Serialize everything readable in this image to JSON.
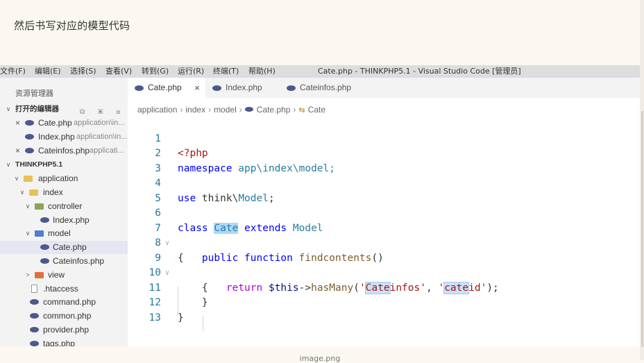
{
  "article": {
    "text": "然后书写对应的模型代码"
  },
  "caption": "image.png",
  "window": {
    "menu": [
      "文件(F)",
      "编辑(E)",
      "选择(S)",
      "查看(V)",
      "转到(G)",
      "运行(R)",
      "终端(T)",
      "帮助(H)"
    ],
    "title": "Cate.php - THINKPHP5.1 - Visual Studio Code [管理员]"
  },
  "explorer": {
    "title": "资源管理器",
    "open_editors_label": "打开的编辑器",
    "open_editors_actions": "⧉ ▣ ⧈",
    "open_editors": [
      {
        "name": "Cate.php",
        "path": "application\\in...",
        "close": "×"
      },
      {
        "name": "Index.php",
        "path": "application\\in...",
        "close": ""
      },
      {
        "name": "Cateinfos.php",
        "path": "applicati...",
        "close": "×"
      }
    ],
    "project_label": "THINKPHP5.1",
    "tree": [
      {
        "name": "application",
        "chev": "∨",
        "icon": "folder"
      },
      {
        "name": "index",
        "chev": "∨",
        "icon": "folder"
      },
      {
        "name": "controller",
        "chev": "∨",
        "icon": "folder-ctrl"
      },
      {
        "name": "Index.php",
        "chev": "",
        "icon": "php"
      },
      {
        "name": "model",
        "chev": "∨",
        "icon": "folder-model"
      },
      {
        "name": "Cate.php",
        "chev": "",
        "icon": "php"
      },
      {
        "name": "Cateinfos.php",
        "chev": "",
        "icon": "php"
      },
      {
        "name": "view",
        "chev": ">",
        "icon": "folder-view"
      },
      {
        "name": ".htaccess",
        "chev": "",
        "icon": "file"
      },
      {
        "name": "command.php",
        "chev": "",
        "icon": "php"
      },
      {
        "name": "common.php",
        "chev": "",
        "icon": "php"
      },
      {
        "name": "provider.php",
        "chev": "",
        "icon": "php"
      },
      {
        "name": "tags.php",
        "chev": "",
        "icon": "php"
      }
    ]
  },
  "tabs": [
    {
      "label": "Cate.php",
      "close": "×"
    },
    {
      "label": "Index.php"
    },
    {
      "label": "Cateinfos.php"
    }
  ],
  "breadcrumb": {
    "parts": [
      "application",
      "index",
      "model"
    ],
    "file": "Cate.php",
    "class": "Cate",
    "class_icon": "⇆"
  },
  "code": {
    "line_numbers": [
      "1",
      "2",
      "3",
      "4",
      "5",
      "6",
      "7",
      "8",
      "9",
      "10",
      "11",
      "12",
      "13"
    ],
    "l1": "<?php",
    "l2_kw": "namespace",
    "l2_ns": " app\\index\\model;",
    "l4_kw": "use",
    "l4_a": " think\\",
    "l4_b": "Model",
    "l4_c": ";",
    "l6_kw1": "class",
    "l6_name": "Cate",
    "l6_kw2": "extends",
    "l6_base": "Model",
    "l7": "{",
    "l8_kw1": "public",
    "l8_kw2": "function",
    "l8_fn": "findcontents",
    "l8_p": "()",
    "l9": "{",
    "l10_ret": "return",
    "l10_var": "$this",
    "l10_arrow": "->",
    "l10_fn": "hasMany",
    "l10_p1": "(",
    "l10_s1a": "'",
    "l10_s1b": "Cate",
    "l10_s1c": "infos'",
    "l10_comma": ", ",
    "l10_s2a": "'",
    "l10_s2b": "cate",
    "l10_s2c": "id'",
    "l10_end": ");",
    "l11": "}",
    "l12": "}",
    "fold": "∨"
  }
}
